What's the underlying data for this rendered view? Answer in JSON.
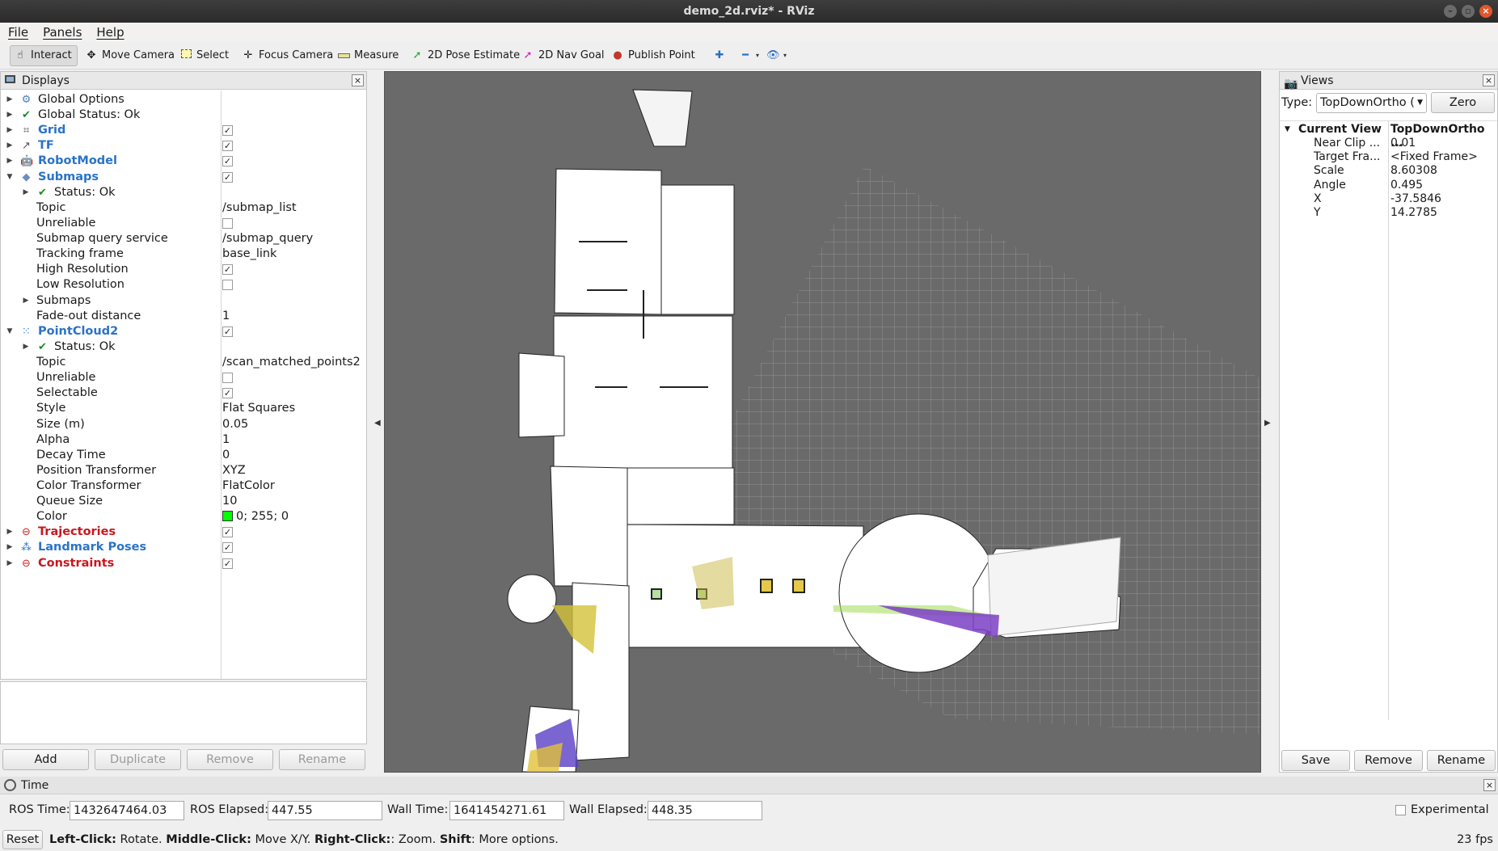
{
  "window": {
    "title": "demo_2d.rviz* - RViz"
  },
  "menu": [
    "File",
    "Panels",
    "Help"
  ],
  "toolbar": [
    {
      "label": "Interact",
      "icon": "cursor-icon",
      "active": true
    },
    {
      "label": "Move Camera",
      "icon": "move-camera-icon"
    },
    {
      "label": "Select",
      "icon": "select-box-icon"
    },
    {
      "label": "Focus Camera",
      "icon": "focus-camera-icon"
    },
    {
      "label": "Measure",
      "icon": "ruler-icon"
    },
    {
      "label": "2D Pose Estimate",
      "icon": "green-arrow-icon",
      "color": "#2aa02a"
    },
    {
      "label": "2D Nav Goal",
      "icon": "magenta-arrow-icon",
      "color": "#d01fb0"
    },
    {
      "label": "Publish Point",
      "icon": "map-pin-icon",
      "color": "#c0392b"
    }
  ],
  "displays": {
    "title": "Displays",
    "rows": [
      {
        "label": "Global Options",
        "indent": 0,
        "arrow": "right",
        "icon": "gear-icon"
      },
      {
        "label": "Global Status: Ok",
        "indent": 0,
        "arrow": "right",
        "icon": "check-icon"
      },
      {
        "label": "Grid",
        "indent": 0,
        "arrow": "right",
        "icon": "grid-icon",
        "style": "blue",
        "check": true
      },
      {
        "label": "TF",
        "indent": 0,
        "arrow": "right",
        "icon": "tf-icon",
        "style": "blue",
        "check": true
      },
      {
        "label": "RobotModel",
        "indent": 0,
        "arrow": "right",
        "icon": "robot-icon",
        "style": "blue",
        "check": true
      },
      {
        "label": "Submaps",
        "indent": 0,
        "arrow": "down",
        "icon": "diamond-icon",
        "style": "blue",
        "check": true
      },
      {
        "label": "Status: Ok",
        "indent": 1,
        "arrow": "right",
        "icon": "check-icon"
      },
      {
        "label": "Topic",
        "indent": 1,
        "value": "/submap_list"
      },
      {
        "label": "Unreliable",
        "indent": 1,
        "check": false
      },
      {
        "label": "Submap query service",
        "indent": 1,
        "value": "/submap_query"
      },
      {
        "label": "Tracking frame",
        "indent": 1,
        "value": "base_link"
      },
      {
        "label": "High Resolution",
        "indent": 1,
        "check": true
      },
      {
        "label": "Low Resolution",
        "indent": 1,
        "check": false
      },
      {
        "label": "Submaps",
        "indent": 1,
        "arrow": "right"
      },
      {
        "label": "Fade-out distance",
        "indent": 1,
        "value": "1"
      },
      {
        "label": "PointCloud2",
        "indent": 0,
        "arrow": "down",
        "icon": "pointcloud-icon",
        "style": "blue",
        "check": true
      },
      {
        "label": "Status: Ok",
        "indent": 1,
        "arrow": "right",
        "icon": "check-icon"
      },
      {
        "label": "Topic",
        "indent": 1,
        "value": "/scan_matched_points2"
      },
      {
        "label": "Unreliable",
        "indent": 1,
        "check": false
      },
      {
        "label": "Selectable",
        "indent": 1,
        "check": true
      },
      {
        "label": "Style",
        "indent": 1,
        "value": "Flat Squares"
      },
      {
        "label": "Size (m)",
        "indent": 1,
        "value": "0.05"
      },
      {
        "label": "Alpha",
        "indent": 1,
        "value": "1"
      },
      {
        "label": "Decay Time",
        "indent": 1,
        "value": "0"
      },
      {
        "label": "Position Transformer",
        "indent": 1,
        "value": "XYZ"
      },
      {
        "label": "Color Transformer",
        "indent": 1,
        "value": "FlatColor"
      },
      {
        "label": "Queue Size",
        "indent": 1,
        "value": "10"
      },
      {
        "label": "Color",
        "indent": 1,
        "value": "0; 255; 0",
        "swatch": "#00ff00"
      },
      {
        "label": "Trajectories",
        "indent": 0,
        "arrow": "right",
        "icon": "error-icon",
        "style": "red",
        "check": true
      },
      {
        "label": "Landmark Poses",
        "indent": 0,
        "arrow": "right",
        "icon": "landmark-icon",
        "style": "blue",
        "check": true
      },
      {
        "label": "Constraints",
        "indent": 0,
        "arrow": "right",
        "icon": "error-icon",
        "style": "red",
        "check": true
      }
    ],
    "buttons": {
      "add": "Add",
      "duplicate": "Duplicate",
      "remove": "Remove",
      "rename": "Rename"
    }
  },
  "views": {
    "title": "Views",
    "type_label": "Type:",
    "type_value": "TopDownOrtho (",
    "zero": "Zero",
    "current_view": {
      "label": "Current View",
      "value": "TopDownOrtho ..."
    },
    "props": [
      {
        "k": "Near Clip ...",
        "v": "0.01"
      },
      {
        "k": "Target Fra...",
        "v": "<Fixed Frame>"
      },
      {
        "k": "Scale",
        "v": "8.60308"
      },
      {
        "k": "Angle",
        "v": "0.495"
      },
      {
        "k": "X",
        "v": "-37.5846"
      },
      {
        "k": "Y",
        "v": "14.2785"
      }
    ],
    "buttons": {
      "save": "Save",
      "remove": "Remove",
      "rename": "Rename"
    }
  },
  "time": {
    "title": "Time",
    "ros_time_label": "ROS Time:",
    "ros_time": "1432647464.03",
    "ros_elapsed_label": "ROS Elapsed:",
    "ros_elapsed": "447.55",
    "wall_time_label": "Wall Time:",
    "wall_time": "1641454271.61",
    "wall_elapsed_label": "Wall Elapsed:",
    "wall_elapsed": "448.35",
    "experimental": "Experimental"
  },
  "status": {
    "reset": "Reset",
    "hint_b1": "Left-Click:",
    "hint_t1": " Rotate. ",
    "hint_b2": "Middle-Click:",
    "hint_t2": " Move X/Y. ",
    "hint_b3": "Right-Click:",
    "hint_t3": ": Zoom. ",
    "hint_b4": "Shift",
    "hint_t4": ": More options.",
    "fps": "23 fps"
  }
}
